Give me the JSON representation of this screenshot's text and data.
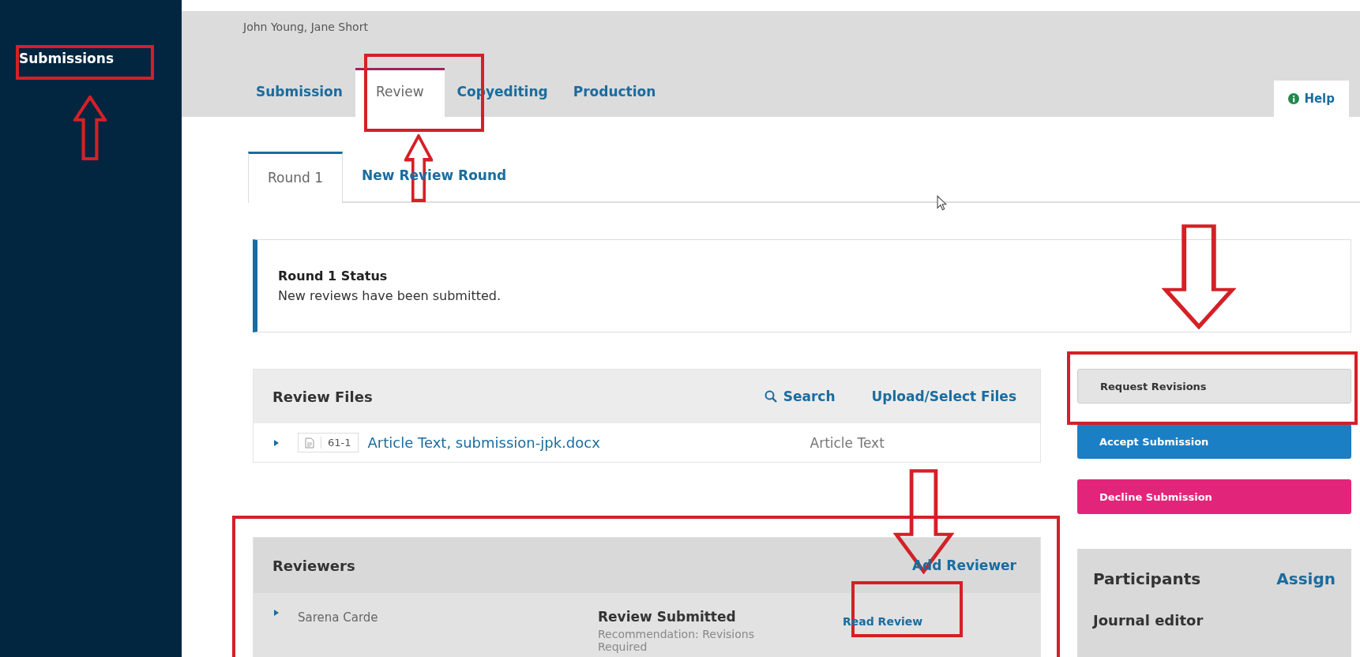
{
  "sidebar": {
    "items": [
      {
        "label": "Submissions",
        "selected": true
      }
    ]
  },
  "header": {
    "authors": "John Young, Jane Short",
    "tabs": [
      {
        "label": "Submission",
        "selected": false
      },
      {
        "label": "Review",
        "selected": true
      },
      {
        "label": "Copyediting",
        "selected": false
      },
      {
        "label": "Production",
        "selected": false
      }
    ],
    "help": "Help"
  },
  "round_tabs": [
    {
      "label": "Round 1",
      "selected": true
    },
    {
      "label": "New Review Round",
      "selected": false
    }
  ],
  "status": {
    "title": "Round 1 Status",
    "message": "New reviews have been submitted."
  },
  "review_files": {
    "title": "Review Files",
    "search": "Search",
    "upload": "Upload/Select Files",
    "files": [
      {
        "id": "61-1",
        "name": "Article Text, submission-jpk.docx",
        "type": "Article Text",
        "expanded": false
      }
    ]
  },
  "reviewers": {
    "title": "Reviewers",
    "action": "Add Reviewer",
    "rows": [
      {
        "name": "Sarena Carde",
        "status": "Review Submitted",
        "recommendation": "Recommendation: Revisions Required",
        "action": "Read Review",
        "expanded": false
      }
    ]
  },
  "decisions": [
    {
      "label": "Request Revisions",
      "kind": "default"
    },
    {
      "label": "Accept Submission",
      "kind": "primary"
    },
    {
      "label": "Decline Submission",
      "kind": "negative"
    }
  ],
  "participants": {
    "title": "Participants",
    "action": "Assign",
    "groups": [
      "Journal editor"
    ]
  }
}
